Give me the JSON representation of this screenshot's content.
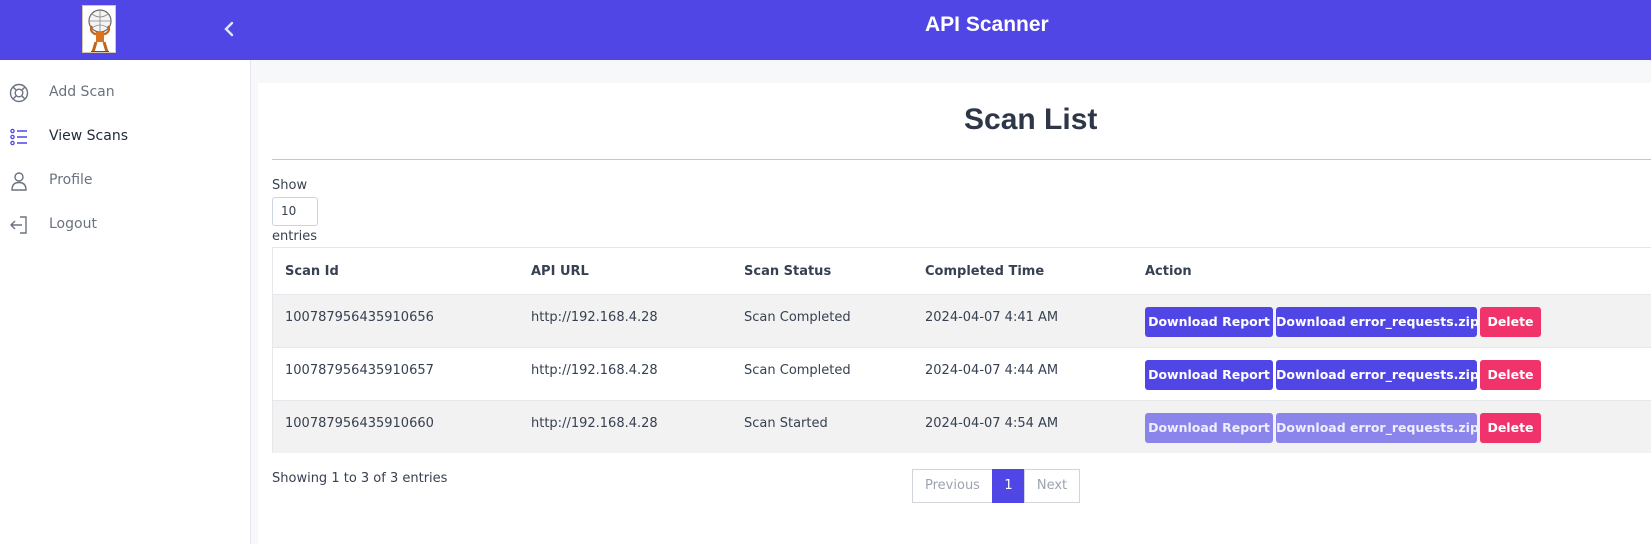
{
  "header": {
    "title": "API Scanner"
  },
  "sidebar": {
    "items": [
      {
        "label": "Add Scan",
        "icon": "lifebuoy-icon"
      },
      {
        "label": "View Scans",
        "icon": "list-icon"
      },
      {
        "label": "Profile",
        "icon": "user-icon"
      },
      {
        "label": "Logout",
        "icon": "logout-icon"
      }
    ]
  },
  "main": {
    "title": "Scan List",
    "length_menu": {
      "before": "Show",
      "value": "10",
      "after": "entries"
    },
    "table": {
      "headers": [
        "Scan Id",
        "API URL",
        "Scan Status",
        "Completed Time",
        "Action"
      ],
      "rows": [
        {
          "scan_id": "100787956435910656",
          "api_url": "http://192.168.4.28",
          "status": "Scan Completed",
          "completed_time": "2024-04-07 4:41 AM",
          "downloads_enabled": true
        },
        {
          "scan_id": "100787956435910657",
          "api_url": "http://192.168.4.28",
          "status": "Scan Completed",
          "completed_time": "2024-04-07 4:44 AM",
          "downloads_enabled": true
        },
        {
          "scan_id": "100787956435910660",
          "api_url": "http://192.168.4.28",
          "status": "Scan Started",
          "completed_time": "2024-04-07 4:54 AM",
          "downloads_enabled": false
        }
      ],
      "actions": {
        "download_report": "Download Report",
        "download_errors": "Download error_requests.zip",
        "delete": "Delete"
      }
    },
    "info": "Showing 1 to 3 of 3 entries",
    "pagination": {
      "previous": "Previous",
      "current": "1",
      "next": "Next"
    }
  },
  "colors": {
    "brand": "#4f46e5",
    "danger": "#f0336b",
    "disabled": "#8b84ea"
  }
}
